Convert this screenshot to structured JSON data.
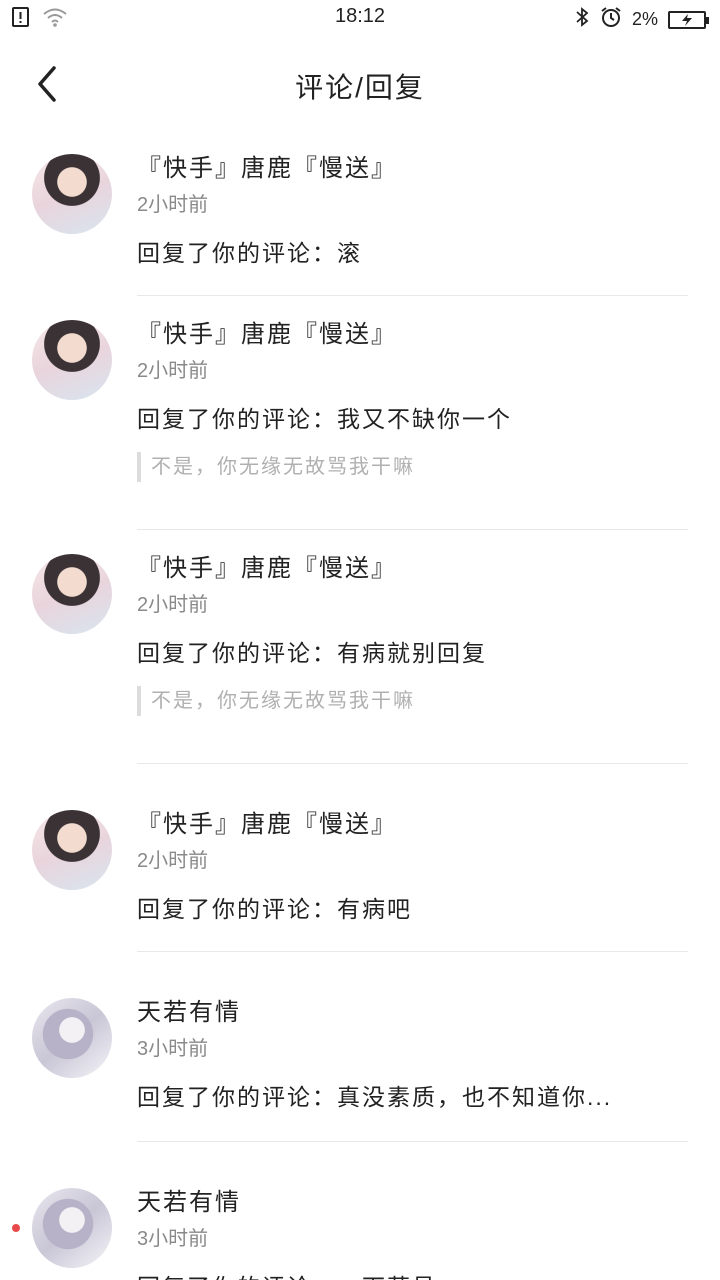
{
  "status_bar": {
    "time": "18:12",
    "battery_percent": "2%",
    "icons": [
      "sim-alert-icon",
      "wifi-icon",
      "bluetooth-icon",
      "alarm-icon",
      "battery-charging-icon"
    ]
  },
  "header": {
    "title": "评论/回复",
    "back_icon": "chevron-left-icon"
  },
  "items": [
    {
      "name": "『快手』唐鹿『慢送』",
      "time": "2小时前",
      "content": "回复了你的评论：滚",
      "quote": ""
    },
    {
      "name": "『快手』唐鹿『慢送』",
      "time": "2小时前",
      "content": "回复了你的评论：我又不缺你一个",
      "quote": "不是，你无缘无故骂我干嘛"
    },
    {
      "name": "『快手』唐鹿『慢送』",
      "time": "2小时前",
      "content": "回复了你的评论：有病就别回复",
      "quote": "不是，你无缘无故骂我干嘛"
    },
    {
      "name": "『快手』唐鹿『慢送』",
      "time": "2小时前",
      "content": "回复了你的评论：有病吧",
      "quote": ""
    },
    {
      "name": "天若有情",
      "time": "3小时前",
      "content": "回复了你的评论：真没素质，也不知道你...",
      "quote": ""
    },
    {
      "name": "天若有情",
      "time": "3小时前",
      "content": "回复了你的评论：一下草号",
      "quote": ""
    }
  ]
}
